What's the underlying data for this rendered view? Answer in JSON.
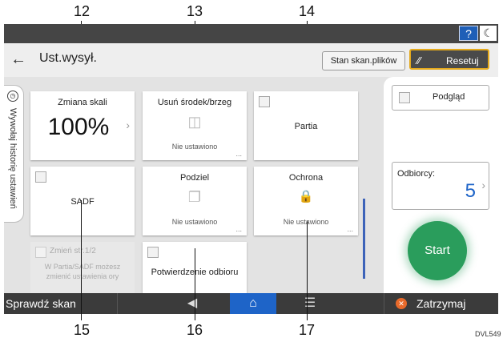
{
  "callouts": {
    "c12": "12",
    "c13": "13",
    "c14": "14",
    "c15": "15",
    "c16": "16",
    "c17": "17"
  },
  "statusbar": {
    "help_label": "?",
    "night_icon": "moon-icon",
    "night_glyph": "☾"
  },
  "header": {
    "back_glyph": "←",
    "title": "Ust.wysył.",
    "scan_status_label": "Stan skan.plików",
    "reset_label": "Resetuj",
    "reset_icon": "reset-icon",
    "reset_glyph": "⁄⁄"
  },
  "history_tab": {
    "label": "Wywołaj historię ustawień",
    "clock_glyph": "◷"
  },
  "tiles": {
    "scale": {
      "name": "Zmiana skali",
      "value": "100%",
      "chevron": "›"
    },
    "erase": {
      "name": "Usuń środek/brzeg",
      "status": "Nie ustawiono",
      "dots": "...",
      "glyph": "◫"
    },
    "batch": {
      "name": "Partia"
    },
    "sadf": {
      "name": "SADF"
    },
    "divide": {
      "name": "Podziel",
      "status": "Nie ustawiono",
      "dots": "...",
      "glyph": "❐"
    },
    "protect": {
      "name": "Ochrona",
      "status": "Nie ustawiono",
      "dots": "...",
      "glyph": "🔒"
    },
    "change": {
      "name": "Zmień str.1/2",
      "note_line1": "W Partia/SADF możesz",
      "note_line2": "zmienić ustawienia ory"
    },
    "receipt": {
      "name": "Potwierdzenie odbioru"
    }
  },
  "right_panel": {
    "preview_label": "Podgląd",
    "recipients_label": "Odbiorcy:",
    "recipients_count": "5",
    "chevron": "›",
    "start_label": "Start"
  },
  "bottombar": {
    "check_scan_label": "Sprawdź skan",
    "back_glyph": "◀",
    "home_glyph": "⌂",
    "menu_glyph": "☰",
    "stop_label": "Zatrzymaj",
    "stop_glyph": "✕"
  },
  "footer": {
    "code": "DVL549"
  },
  "colors": {
    "accent_blue": "#1e64c8",
    "start_green": "#2a9d5c",
    "reset_border": "#e4a91c",
    "stop_orange": "#e86a2b"
  }
}
